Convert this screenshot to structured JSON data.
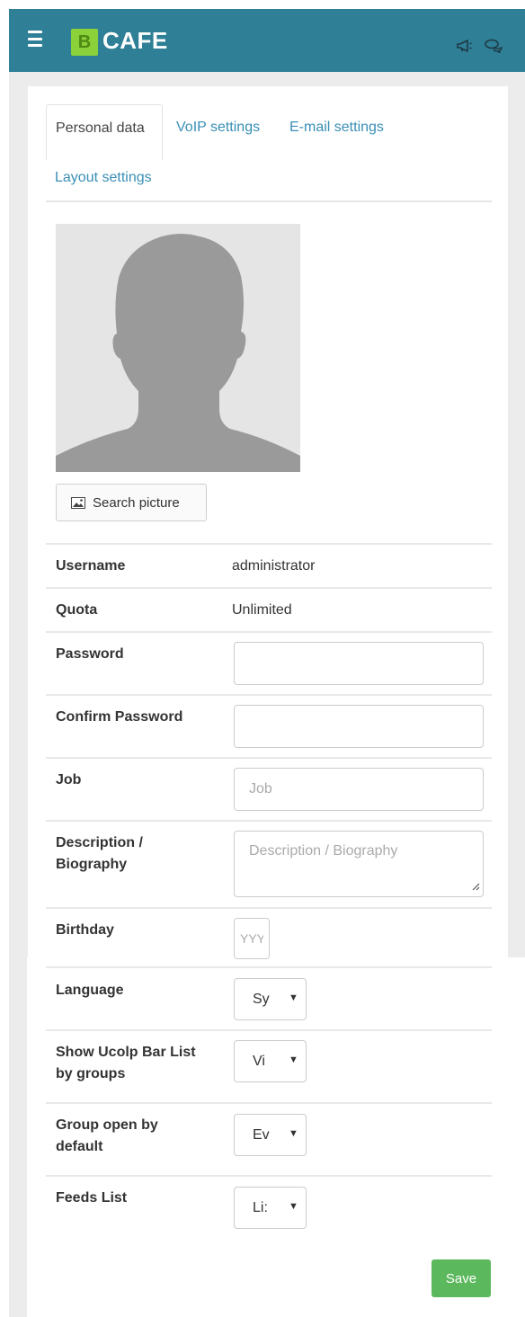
{
  "header": {
    "logo_letter": "B",
    "brand": "CAFE",
    "icons": [
      "menu-icon",
      "megaphone-icon",
      "chat-icon"
    ],
    "bar_color": "#2f7f97",
    "logo_color": "#8bd13a"
  },
  "tabs": [
    {
      "label": "Personal data",
      "active": true
    },
    {
      "label": "VoIP settings",
      "active": false
    },
    {
      "label": "E-mail settings",
      "active": false
    },
    {
      "label": "Layout settings",
      "active": false
    }
  ],
  "profile": {
    "search_picture_label": "Search picture"
  },
  "fields": {
    "username": {
      "label": "Username",
      "value": "administrator"
    },
    "quota": {
      "label": "Quota",
      "value": "Unlimited"
    },
    "password": {
      "label": "Password",
      "value": ""
    },
    "confirm_password": {
      "label": "Confirm Password",
      "value": ""
    },
    "job": {
      "label": "Job",
      "placeholder": "Job"
    },
    "description": {
      "label_line1": "Description /",
      "label_line2": "Biography",
      "placeholder": "Description / Biography"
    },
    "birthday": {
      "label": "Birthday",
      "placeholder": "YYYY-"
    },
    "language": {
      "label": "Language",
      "selected": "Sy"
    },
    "ucolp_bar": {
      "label_line1": "Show Ucolp Bar List",
      "label_line2": "by groups",
      "selected": "Vi"
    },
    "group_open": {
      "label_line1": "Group open by",
      "label_line2": "default",
      "selected": "Ev"
    },
    "feeds_list": {
      "label": "Feeds List",
      "selected": "Li:"
    }
  },
  "actions": {
    "save_label": "Save",
    "save_color": "#5cb85c"
  }
}
